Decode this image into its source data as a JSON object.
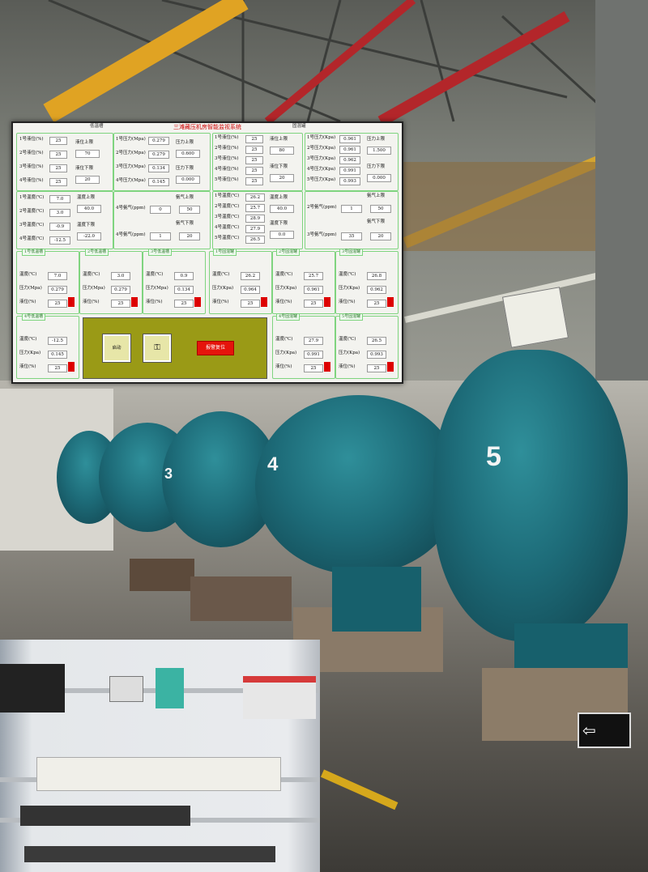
{
  "hmi": {
    "title": "三滩藏压机房智能监视系统",
    "header_left": "低温槽",
    "header_right": "固混罐",
    "tanks_level": [
      {
        "label": "1号液位(%)",
        "value": "25"
      },
      {
        "label": "2号液位(%)",
        "value": "25"
      },
      {
        "label": "3号液位(%)",
        "value": "25"
      },
      {
        "label": "4号液位(%)",
        "value": "25"
      }
    ],
    "level_limits": {
      "upper_label": "液位上限",
      "upper": "70",
      "lower_label": "液位下限",
      "lower": "20"
    },
    "pressure_mid": [
      {
        "label": "1号压力(Mpa)",
        "value": "0.279"
      },
      {
        "label": "2号压力(Mpa)",
        "value": "0.279"
      },
      {
        "label": "3号压力(Mpa)",
        "value": "0.134"
      },
      {
        "label": "4号压力(Mpa)",
        "value": "0.145"
      }
    ],
    "pressure_mid_limits": {
      "upper_label": "压力上限",
      "upper": "0.600",
      "lower_label": "压力下限",
      "lower": "0.000"
    },
    "right_level": [
      {
        "label": "1号液位(%)",
        "value": "25"
      },
      {
        "label": "2号液位(%)",
        "value": "25"
      },
      {
        "label": "3号液位(%)",
        "value": "25"
      },
      {
        "label": "4号液位(%)",
        "value": "25"
      },
      {
        "label": "5号液位(%)",
        "value": "25"
      }
    ],
    "right_level_limits": {
      "upper_label": "液位上限",
      "upper": "80",
      "lower_label": "液位下限",
      "lower": "20"
    },
    "right_pressure": [
      {
        "label": "1号压力(Kpa)",
        "value": "0.961"
      },
      {
        "label": "2号压力(Kpa)",
        "value": "0.961"
      },
      {
        "label": "3号压力(Kpa)",
        "value": "0.962"
      },
      {
        "label": "4号压力(Kpa)",
        "value": "0.991"
      },
      {
        "label": "5号压力(Kpa)",
        "value": "0.993"
      }
    ],
    "right_pressure_limits": {
      "upper_label": "压力上限",
      "upper": "1.500",
      "lower_label": "压力下限",
      "lower": "0.000"
    },
    "temps_left": [
      {
        "label": "1号温度(℃)",
        "value": "7.0"
      },
      {
        "label": "2号温度(℃)",
        "value": "3.0"
      },
      {
        "label": "3号温度(℃)",
        "value": "-0.9"
      },
      {
        "label": "4号温度(℃)",
        "value": "-12.5"
      }
    ],
    "temp_left_limits": {
      "upper_label": "温度上限",
      "upper": "40.0",
      "lower_label": "温度下限",
      "lower": "-22.0"
    },
    "ammonia_left": {
      "rows": [
        {
          "label": "4号氨气(ppm)",
          "value": "0"
        },
        {
          "label": "4号氨气(ppm)",
          "value": "1"
        }
      ],
      "upper_label": "氨气上限",
      "upper": "50",
      "lower_label": "氨气下限",
      "lower": "20"
    },
    "temps_right": [
      {
        "label": "1号温度(℃)",
        "value": "26.2"
      },
      {
        "label": "2号温度(℃)",
        "value": "25.7"
      },
      {
        "label": "3号温度(℃)",
        "value": "28.9"
      },
      {
        "label": "4号温度(℃)",
        "value": "27.9"
      },
      {
        "label": "5号温度(℃)",
        "value": "26.5"
      }
    ],
    "temp_right_limits": {
      "upper_label": "温度上限",
      "upper": "40.0",
      "lower_label": "温度下限",
      "lower": "0.0"
    },
    "ammonia_right": {
      "rows": [
        {
          "label": "2号氨气(ppm)",
          "value": "1"
        },
        {
          "label": "3号氨气(ppm)",
          "value": "35"
        }
      ],
      "upper_label": "氨气上限",
      "upper": "50",
      "lower_label": "氨气下限",
      "lower": "20"
    },
    "unit_panels": [
      {
        "tab": "1号低温槽",
        "temp_label": "温度(℃)",
        "temp": "7.0",
        "press_label": "压力(Mpa)",
        "press": "0.279",
        "level_label": "液位(%)",
        "level": "25"
      },
      {
        "tab": "2号低温槽",
        "temp_label": "温度(℃)",
        "temp": "3.0",
        "press_label": "压力(Mpa)",
        "press": "0.279",
        "level_label": "液位(%)",
        "level": "25"
      },
      {
        "tab": "3号低温槽",
        "temp_label": "温度(℃)",
        "temp": "0.9",
        "press_label": "压力(Mpa)",
        "press": "0.134",
        "level_label": "液位(%)",
        "level": "25"
      },
      {
        "tab": "1号固混罐",
        "temp_label": "温度(℃)",
        "temp": "26.2",
        "press_label": "压力(Kpa)",
        "press": "0.964",
        "level_label": "液位(%)",
        "level": "25"
      },
      {
        "tab": "2号固混罐",
        "temp_label": "温度(℃)",
        "temp": "25.7",
        "press_label": "压力(Kpa)",
        "press": "0.961",
        "level_label": "液位(%)",
        "level": "25"
      },
      {
        "tab": "3号固混罐",
        "temp_label": "温度(℃)",
        "temp": "26.8",
        "press_label": "压力(Kpa)",
        "press": "0.962",
        "level_label": "液位(%)",
        "level": "25"
      }
    ],
    "unit_panels_bottom": [
      {
        "tab": "4号低温槽",
        "temp_label": "温度(℃)",
        "temp": "-12.5",
        "press_label": "压力(Kpa)",
        "press": "0.145",
        "level_label": "液位(%)",
        "level": "25"
      },
      {
        "tab": "4号固混罐",
        "temp_label": "温度(℃)",
        "temp": "27.9",
        "press_label": "压力(Kpa)",
        "press": "0.991",
        "level_label": "液位(%)",
        "level": "25"
      },
      {
        "tab": "5号固混罐",
        "temp_label": "温度(℃)",
        "temp": "26.5",
        "press_label": "压力(Kpa)",
        "press": "0.993",
        "level_label": "液位(%)",
        "level": "25"
      }
    ],
    "control": {
      "start_label": "启动",
      "reset_label": "",
      "clear_label": "报警复位"
    }
  },
  "scene": {
    "tank_numbers": [
      "3",
      "4",
      "5"
    ],
    "exit_sign": "",
    "nameplate_rows": [
      "",
      "",
      ""
    ]
  }
}
